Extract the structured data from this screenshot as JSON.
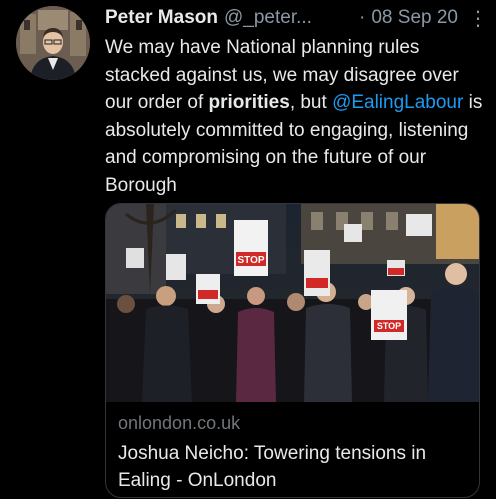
{
  "tweet": {
    "author_name": "Peter Mason",
    "author_handle": "@_peter...",
    "separator": "·",
    "date": "08 Sep 20",
    "more_icon": "more-vertical-icon",
    "text_parts": [
      {
        "text": "We may have National planning rules stacked against us, we may disagree over our order of ",
        "style": "normal"
      },
      {
        "text": "priorities",
        "style": "bold"
      },
      {
        "text": ", but ",
        "style": "normal"
      },
      {
        "text": "@EalingLabour",
        "style": "mention"
      },
      {
        "text": " is absolutely committed to engaging, listening and compromising on the future of our Borough",
        "style": "normal"
      }
    ]
  },
  "card": {
    "image_signs": [
      "STOP TOWERS",
      "STOP",
      "STOP TOWERS",
      "STOP",
      "STOP TOWERS",
      "STOP"
    ],
    "domain": "onlondon.co.uk",
    "title": "Joshua Neicho: Towering tensions in Ealing - OnLondon"
  },
  "colors": {
    "background": "#000000",
    "text": "#e7e9ea",
    "secondary": "#8b98a5",
    "link": "#1d9bf0",
    "border": "#333639"
  }
}
